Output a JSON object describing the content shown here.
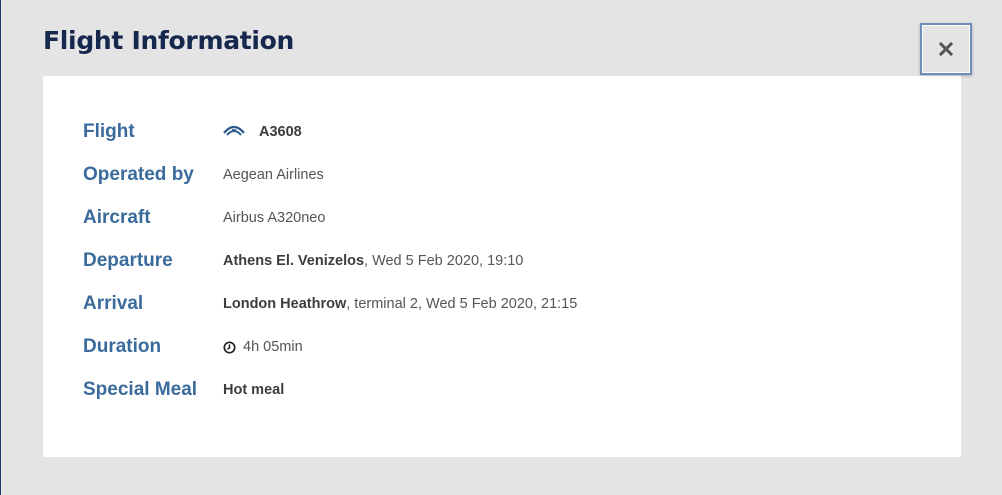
{
  "modal": {
    "title": "Flight Information",
    "close_label": "×"
  },
  "rows": {
    "flight": {
      "label": "Flight",
      "value": "A3608",
      "icon": "airline-logo-icon"
    },
    "operated_by": {
      "label": "Operated by",
      "value": "Aegean Airlines"
    },
    "aircraft": {
      "label": "Aircraft",
      "value": "Airbus A320neo"
    },
    "departure": {
      "label": "Departure",
      "airport": "Athens El. Venizelos",
      "details": ", Wed 5 Feb 2020, 19:10"
    },
    "arrival": {
      "label": "Arrival",
      "airport": "London Heathrow",
      "details": ", terminal 2, Wed 5 Feb 2020, 21:15"
    },
    "duration": {
      "label": "Duration",
      "value": "4h 05min",
      "icon": "clock-icon"
    },
    "special_meal": {
      "label": "Special Meal",
      "value": "Hot meal"
    }
  },
  "colors": {
    "title": "#16284d",
    "label": "#3a6b9c",
    "value": "#555555",
    "background": "#e4e4e4",
    "panel": "#ffffff"
  }
}
